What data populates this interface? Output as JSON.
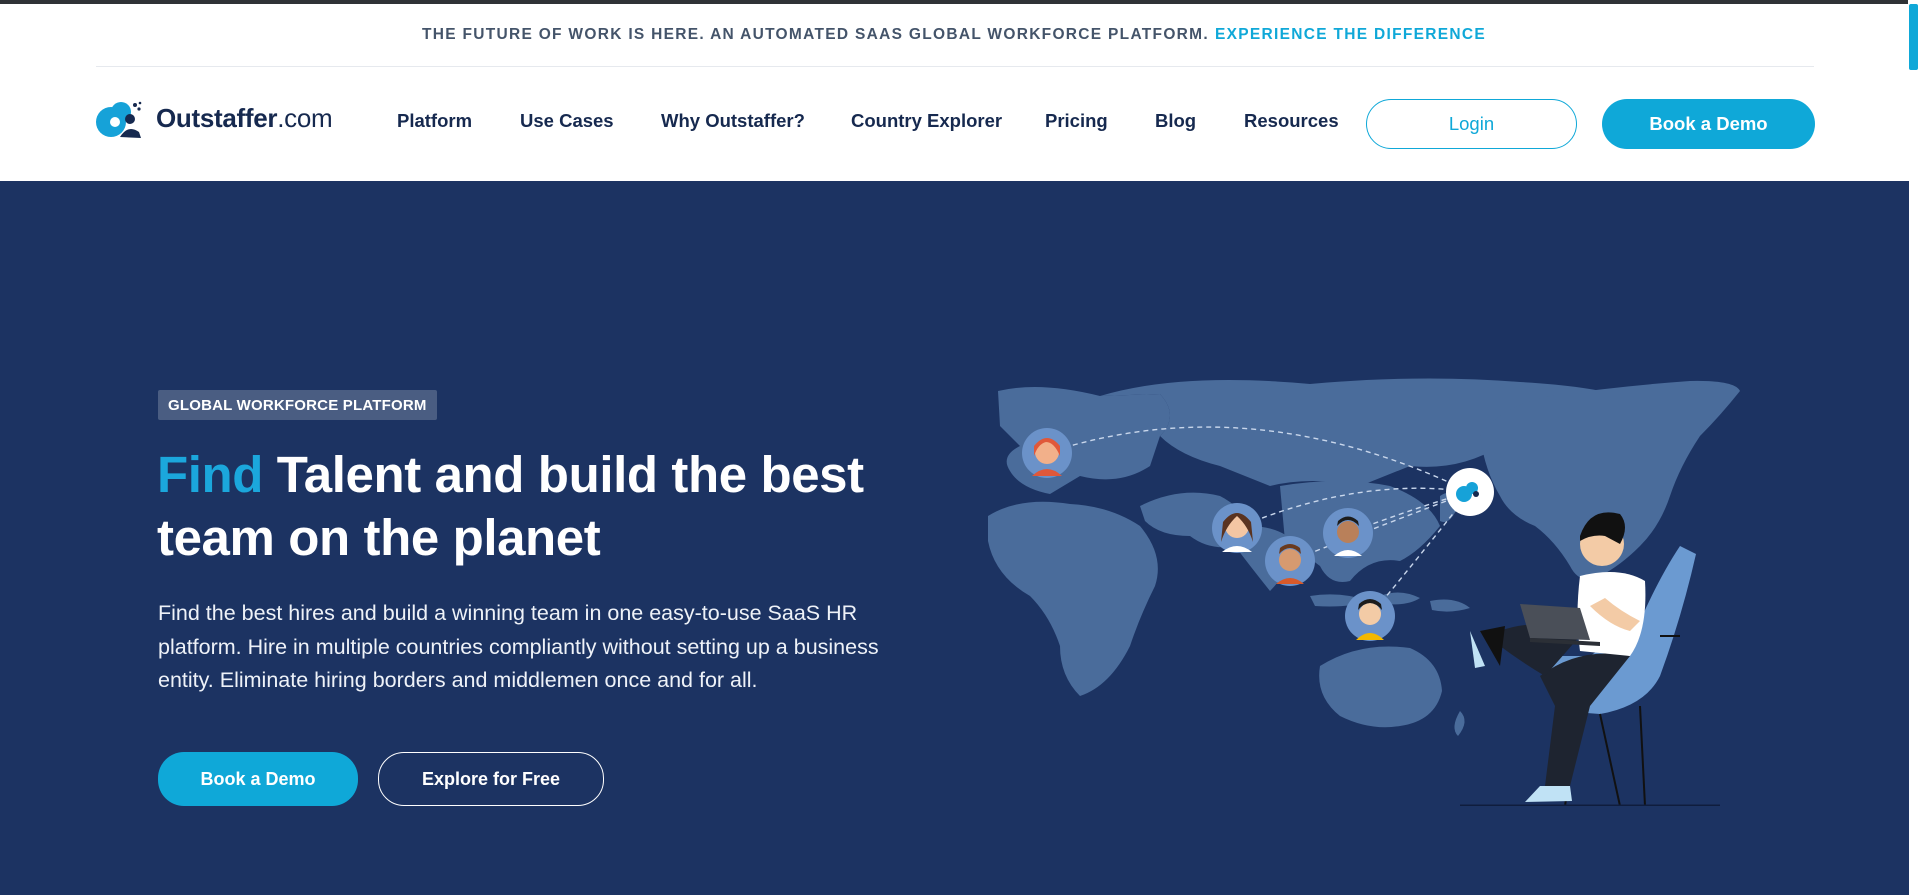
{
  "announcement": {
    "text": "THE FUTURE OF WORK IS HERE. AN AUTOMATED SAAS GLOBAL WORKFORCE PLATFORM.",
    "link": "EXPERIENCE THE DIFFERENCE"
  },
  "header": {
    "logo_name": "Outstaffer",
    "logo_domain": ".com",
    "nav": {
      "platform": "Platform",
      "use_cases": "Use Cases",
      "why": "Why Outstaffer?",
      "country_explorer": "Country Explorer",
      "pricing": "Pricing",
      "blog": "Blog",
      "resources": "Resources"
    },
    "login": "Login",
    "book_demo": "Book a Demo"
  },
  "hero": {
    "badge": "GLOBAL WORKFORCE PLATFORM",
    "headline_accent": "Find",
    "headline_rest": " Talent and build the best team on the planet",
    "description": "Find the best hires and build a winning team in one easy-to-use SaaS HR platform. Hire in multiple countries compliantly without setting up a business entity. Eliminate hiring borders and middlemen once and for all.",
    "primary_cta": "Book a Demo",
    "secondary_cta": "Explore for Free"
  },
  "icons": [
    "logo-icon",
    "world-map",
    "person-avatar",
    "laptop-icon"
  ],
  "colors": {
    "accent": "#0fa8d8",
    "navy": "#16294f",
    "hero_bg": "#1c3362",
    "map": "#4a6c9b"
  }
}
